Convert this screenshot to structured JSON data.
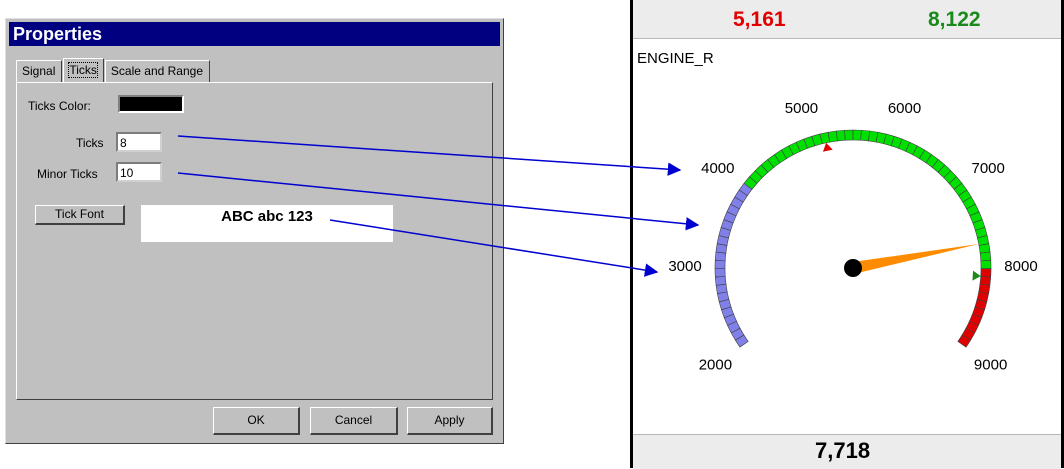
{
  "dialog": {
    "title": "Properties",
    "tabs": [
      "Signal",
      "Ticks",
      "Scale and Range"
    ],
    "ticks_color_label": "Ticks Color:",
    "ticks_color": "#000000",
    "ticks_label": "Ticks",
    "ticks_value": "8",
    "minor_ticks_label": "Minor Ticks",
    "minor_ticks_value": "10",
    "tick_font_button": "Tick Font",
    "font_preview": "ABC abc 123",
    "ok_button": "OK",
    "cancel_button": "Cancel",
    "apply_button": "Apply"
  },
  "gauge": {
    "top_left_value": "5,161",
    "top_right_value": "8,122",
    "name": "ENGINE_R",
    "bottom_value": "7,718",
    "tick_labels": [
      "2000",
      "3000",
      "4000",
      "5000",
      "6000",
      "7000",
      "8000",
      "9000"
    ],
    "min": 2000,
    "max": 9000,
    "needle_value": 7718,
    "low_marker_value": 5161,
    "high_marker_value": 8122,
    "colors": {
      "low_band": "#8080e8",
      "normal_band": "#00e000",
      "high_band": "#e00000",
      "needle": "#ff8c00",
      "value_red": "#e00000",
      "value_green": "#1a8a1a",
      "arrow": "#0000d0"
    },
    "bands": [
      {
        "from": 2000,
        "to": 4000,
        "color": "#8080e8"
      },
      {
        "from": 4000,
        "to": 8000,
        "color": "#00e000"
      },
      {
        "from": 8000,
        "to": 9000,
        "color": "#e00000"
      }
    ]
  }
}
